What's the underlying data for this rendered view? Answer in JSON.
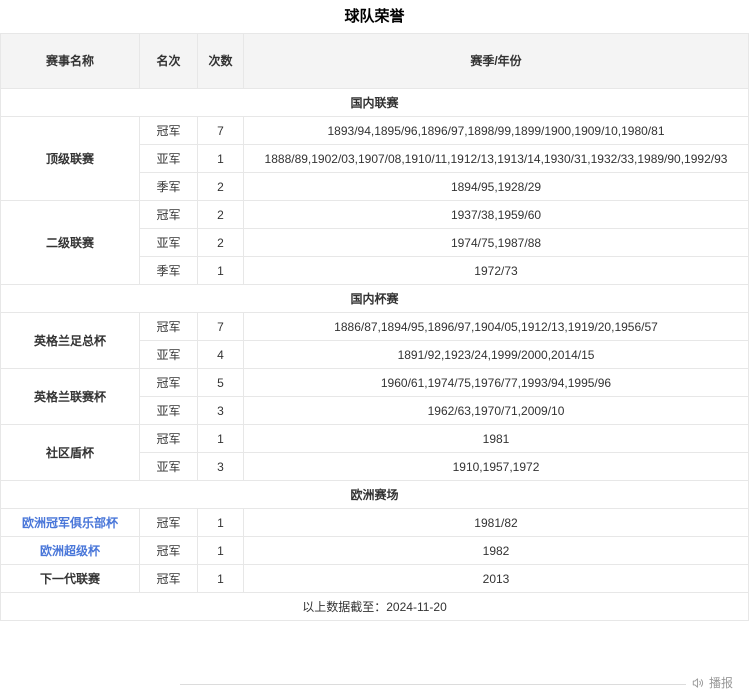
{
  "title": "球队荣誉",
  "table": {
    "headers": [
      "赛事名称",
      "名次",
      "次数",
      "赛季/年份"
    ],
    "sections": [
      {
        "title": "国内联赛",
        "competitions": [
          {
            "name": "顶级联赛",
            "link": false,
            "rows": [
              {
                "rank": "冠军",
                "count": "7",
                "seasons": "1893/94,1895/96,1896/97,1898/99,1899/1900,1909/10,1980/81"
              },
              {
                "rank": "亚军",
                "count": "1",
                "seasons": "1888/89,1902/03,1907/08,1910/11,1912/13,1913/14,1930/31,1932/33,1989/90,1992/93"
              },
              {
                "rank": "季军",
                "count": "2",
                "seasons": "1894/95,1928/29"
              }
            ]
          },
          {
            "name": "二级联赛",
            "link": false,
            "rows": [
              {
                "rank": "冠军",
                "count": "2",
                "seasons": "1937/38,1959/60"
              },
              {
                "rank": "亚军",
                "count": "2",
                "seasons": "1974/75,1987/88"
              },
              {
                "rank": "季军",
                "count": "1",
                "seasons": "1972/73"
              }
            ]
          }
        ]
      },
      {
        "title": "国内杯赛",
        "competitions": [
          {
            "name": "英格兰足总杯",
            "link": false,
            "rows": [
              {
                "rank": "冠军",
                "count": "7",
                "seasons": "1886/87,1894/95,1896/97,1904/05,1912/13,1919/20,1956/57"
              },
              {
                "rank": "亚军",
                "count": "4",
                "seasons": "1891/92,1923/24,1999/2000,2014/15"
              }
            ]
          },
          {
            "name": "英格兰联赛杯",
            "link": false,
            "rows": [
              {
                "rank": "冠军",
                "count": "5",
                "seasons": "1960/61,1974/75,1976/77,1993/94,1995/96"
              },
              {
                "rank": "亚军",
                "count": "3",
                "seasons": "1962/63,1970/71,2009/10"
              }
            ]
          },
          {
            "name": "社区盾杯",
            "link": false,
            "rows": [
              {
                "rank": "冠军",
                "count": "1",
                "seasons": "1981"
              },
              {
                "rank": "亚军",
                "count": "3",
                "seasons": "1910,1957,1972"
              }
            ]
          }
        ]
      },
      {
        "title": "欧洲赛场",
        "competitions": [
          {
            "name": "欧洲冠军俱乐部杯",
            "link": true,
            "rows": [
              {
                "rank": "冠军",
                "count": "1",
                "seasons": "1981/82"
              }
            ]
          },
          {
            "name": "欧洲超级杯",
            "link": true,
            "rows": [
              {
                "rank": "冠军",
                "count": "1",
                "seasons": "1982"
              }
            ]
          },
          {
            "name": "下一代联赛",
            "link": false,
            "rows": [
              {
                "rank": "冠军",
                "count": "1",
                "seasons": "2013"
              }
            ]
          }
        ]
      }
    ],
    "footer_note": "以上数据截至：2024-11-20"
  },
  "tts": {
    "label": "播报",
    "icon": "speaker-icon"
  },
  "colors": {
    "link_blue": "#4a77d9",
    "header_bg": "#f4f4f4",
    "border": "#e7e7e7",
    "muted": "#999999"
  }
}
